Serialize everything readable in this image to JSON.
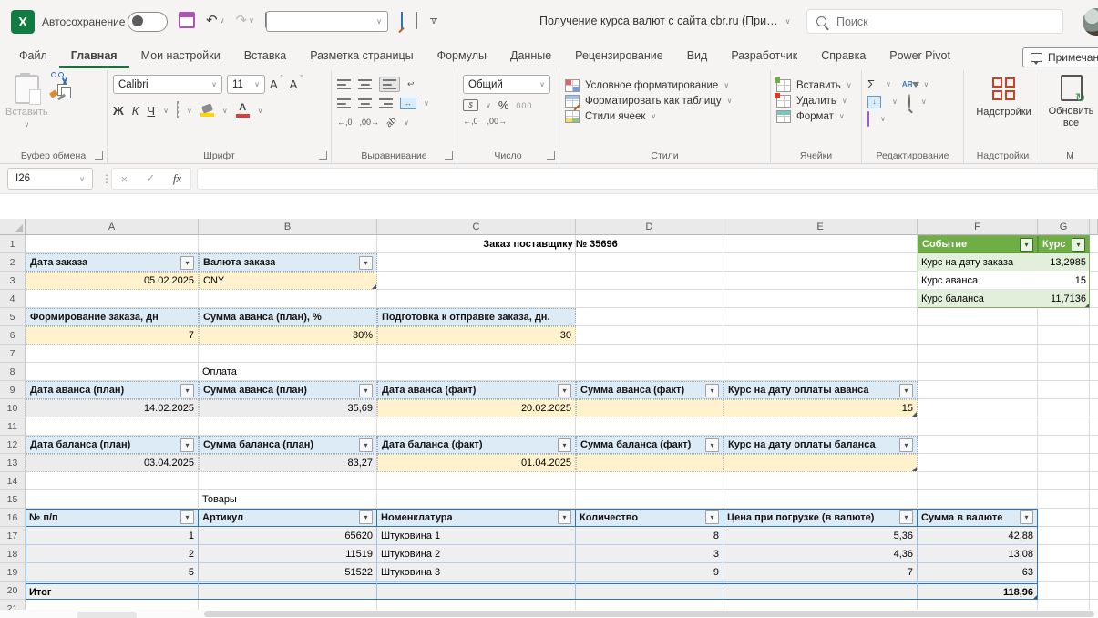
{
  "icons": {
    "filter_arrow": "▾",
    "dropdown": "∨",
    "undo": "↶",
    "redo": "↷",
    "refresh": "↻",
    "close": "×",
    "check": "✓",
    "fx": "fx",
    "dots": "⋮",
    "sigma": "Σ",
    "percent": "%",
    "thousands": "000",
    "bold": "Ж",
    "italic": "К",
    "underline": "Ч",
    "letter_a": "А",
    "grow": "ˆ",
    "shrink": "ˇ",
    "sort_letters": "АЯ",
    "ab": "ab",
    "h_arrows": "↔",
    "arrow_down": "↓",
    "dec_decimal": "←,0",
    "inc_decimal": ",00→",
    "wrap_return": "↩",
    "logo_letter": "X",
    "currency": "$"
  },
  "titlebar": {
    "autosave_label": "Автосохранение",
    "doc_title": "Получение курса валют с сайта cbr.ru (При…",
    "search_placeholder": "Поиск"
  },
  "tabs": [
    "Файл",
    "Главная",
    "Мои настройки",
    "Вставка",
    "Разметка страницы",
    "Формулы",
    "Данные",
    "Рецензирование",
    "Вид",
    "Разработчик",
    "Справка",
    "Power Pivot"
  ],
  "comments_button": "Примечания",
  "ribbon": {
    "clipboard": {
      "label": "Буфер обмена",
      "paste": "Вставить"
    },
    "font": {
      "label": "Шрифт",
      "name": "Calibri",
      "size": "11"
    },
    "alignment": {
      "label": "Выравнивание"
    },
    "number": {
      "label": "Число",
      "format": "Общий"
    },
    "styles": {
      "label": "Стили",
      "cond": "Условное форматирование",
      "table": "Форматировать как таблицу",
      "cell": "Стили ячеек"
    },
    "cells": {
      "label": "Ячейки",
      "insert": "Вставить",
      "delete": "Удалить",
      "format": "Формат"
    },
    "editing": {
      "label": "Редактирование"
    },
    "addins": {
      "label": "Надстройки",
      "button": "Надстройки"
    },
    "refresh_all": {
      "label": "М",
      "button": "Обновить все"
    }
  },
  "formula_bar": {
    "name_box": "I26"
  },
  "sheet": {
    "columns": [
      "A",
      "B",
      "C",
      "D",
      "E",
      "F",
      "G"
    ],
    "row_numbers": [
      "1",
      "2",
      "3",
      "4",
      "5",
      "6",
      "7",
      "8",
      "9",
      "10",
      "11",
      "12",
      "13",
      "14",
      "15",
      "16",
      "17",
      "18",
      "19",
      "20",
      "21"
    ],
    "title": "Заказ поставщику № 35696",
    "order": {
      "headers": [
        "Дата заказа",
        "Валюта заказа"
      ],
      "date": "05.02.2025",
      "currency": "CNY"
    },
    "params": {
      "headers": [
        "Формирование заказа, дн",
        "Сумма аванса (план), %",
        "Подготовка к отправке заказа, дн."
      ],
      "values": [
        "7",
        "30%",
        "30"
      ]
    },
    "rates": {
      "headers": [
        "Событие",
        "Курс"
      ],
      "rows": [
        [
          "Курс на дату заказа",
          "13,2985"
        ],
        [
          "Курс аванса",
          "15"
        ],
        [
          "Курс баланса",
          "11,7136"
        ]
      ]
    },
    "payment_label": "Оплата",
    "advance": {
      "headers": [
        "Дата аванса (план)",
        "Сумма аванса (план)",
        "Дата аванса (факт)",
        "Сумма аванса (факт)",
        "Курс на дату оплаты аванса"
      ],
      "values": [
        "14.02.2025",
        "35,69",
        "20.02.2025",
        "",
        "15"
      ]
    },
    "balance": {
      "headers": [
        "Дата баланса (план)",
        "Сумма баланса (план)",
        "Дата баланса (факт)",
        "Сумма баланса (факт)",
        "Курс на дату оплаты баланса"
      ],
      "values": [
        "03.04.2025",
        "83,27",
        "01.04.2025",
        "",
        ""
      ]
    },
    "goods_label": "Товары",
    "goods": {
      "headers": [
        "№ п/п",
        "Артикул",
        "Номенклатура",
        "Количество",
        "Цена при погрузке (в валюте)",
        "Сумма в валюте"
      ],
      "rows": [
        [
          "1",
          "65620",
          "Штуковина 1",
          "8",
          "5,36",
          "42,88"
        ],
        [
          "2",
          "11519",
          "Штуковина 2",
          "3",
          "4,36",
          "13,08"
        ],
        [
          "5",
          "51522",
          "Штуковина 3",
          "9",
          "7",
          "63"
        ]
      ],
      "total_label": "Итог",
      "total": "118,96"
    }
  },
  "colors": {
    "excel_green": "#217346",
    "table_green": "#6EAE44",
    "band_green": "#E2EFDA",
    "header_blue": "#DDEBF7",
    "input_cream": "#FFF2CC",
    "cell_gray": "#ECECEC",
    "table_border_blue": "#2E75B6"
  }
}
